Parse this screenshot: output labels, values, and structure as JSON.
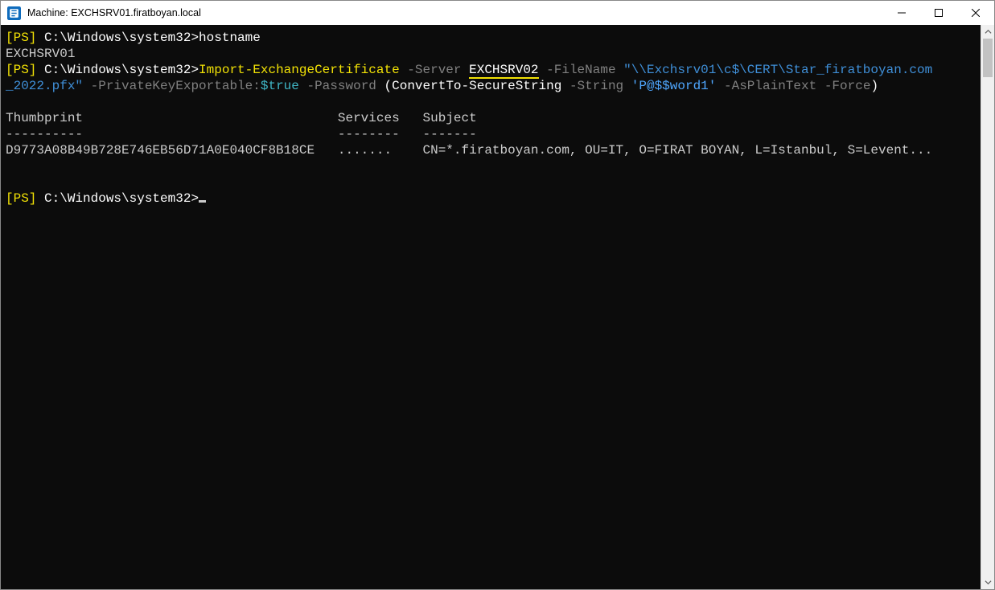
{
  "window": {
    "title": "Machine: EXCHSRV01.firatboyan.local"
  },
  "terminal": {
    "prompt_ps": "[PS]",
    "prompt_path": " C:\\Windows\\system32>",
    "cmd1": "hostname",
    "hostname_output": "EXCHSRV01",
    "cmd2": {
      "cmdlet": "Import-ExchangeCertificate",
      "p_server": " -Server ",
      "v_server": "EXCHSRV02",
      "p_filename": " -FileName ",
      "v_filename_a": "\"\\\\Exchsrv01\\c$\\CERT\\Star_firatboyan.com",
      "v_filename_b": "_2022.pfx\"",
      "p_pke": " -PrivateKeyExportable:",
      "v_true": "$true",
      "p_password": " -Password ",
      "paren_open": "(",
      "convert": "ConvertTo-SecureString",
      "p_string": " -String ",
      "v_string": "'P@$$word1'",
      "p_plain": " -AsPlainText",
      "p_force": " -Force",
      "paren_close": ")"
    },
    "table": {
      "h_thumb": "Thumbprint",
      "h_services": "Services",
      "h_subject": "Subject",
      "sep_thumb": "----------",
      "sep_services": "--------",
      "sep_subject": "-------",
      "row_thumb": "D9773A08B49B728E746EB56D71A0E040CF8B18CE",
      "row_services": ".......",
      "row_subject": "CN=*.firatboyan.com, OU=IT, O=FIRAT BOYAN, L=Istanbul, S=Levent..."
    }
  }
}
